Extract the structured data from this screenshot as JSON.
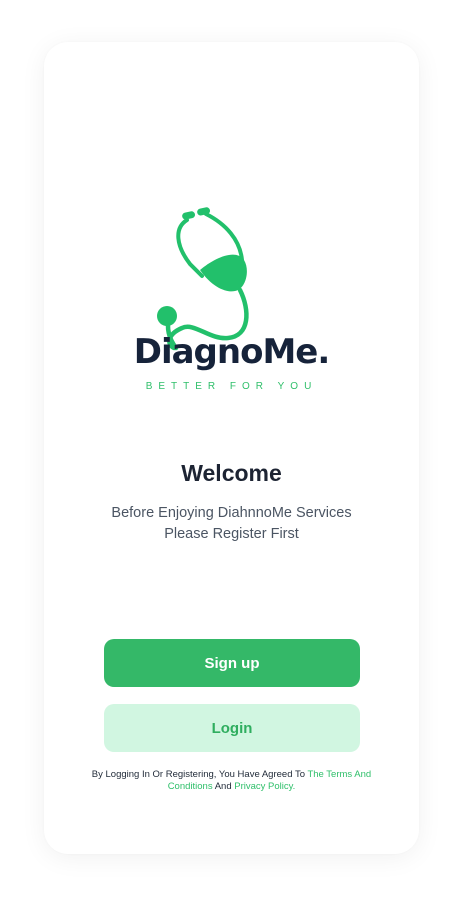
{
  "brand": {
    "name": "DiagnoMe.",
    "tagline": "BETTER FOR YOU",
    "icon": "stethoscope-icon",
    "accent_color": "#2fbf6a",
    "dark_color": "#16233a"
  },
  "welcome": {
    "title": "Welcome",
    "line1": "Before Enjoying DiahnnoMe Services",
    "line2": "Please Register First"
  },
  "actions": {
    "signup_label": "Sign up",
    "login_label": "Login",
    "signup_color": "#34b868",
    "login_bg_color": "#d1f6e1"
  },
  "legal": {
    "prefix": "By Logging In Or Registering, You Have Agreed To ",
    "terms_link": "The Terms And Conditions",
    "connector": " And ",
    "privacy_link": "Privacy Policy."
  }
}
